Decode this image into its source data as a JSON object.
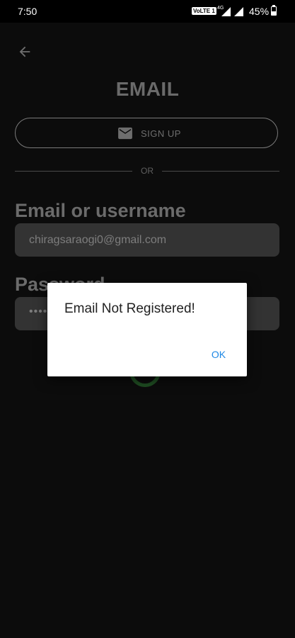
{
  "status_bar": {
    "time": "7:50",
    "volte": "VoLTE 1",
    "network": "4G",
    "battery": "45%"
  },
  "screen": {
    "title": "EMAIL",
    "signup_label": "SIGN UP",
    "divider_text": "OR",
    "email_label": "Email or username",
    "email_value": "chiragsaraogi0@gmail.com",
    "password_label": "Password",
    "password_value": "••••••"
  },
  "dialog": {
    "message": "Email Not Registered!",
    "ok_label": "OK"
  },
  "colors": {
    "background": "#0c0c0c",
    "dialog_button": "#1e88e5",
    "spinner": "#1f4d22"
  },
  "icons": {
    "back": "arrow-left-icon",
    "signup": "mail-icon"
  }
}
